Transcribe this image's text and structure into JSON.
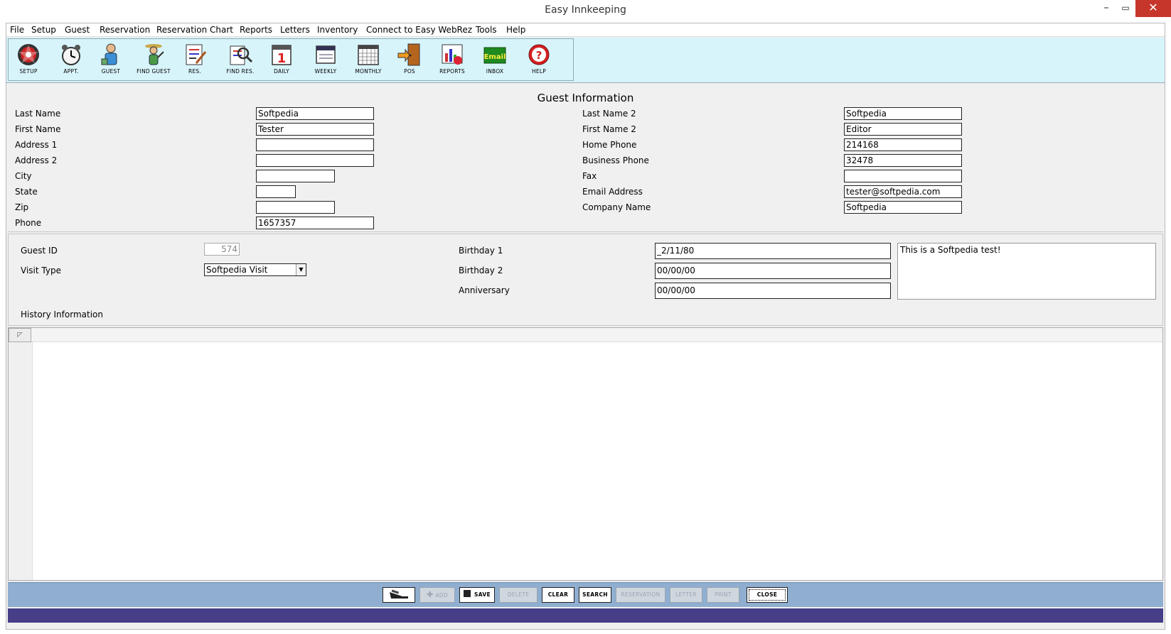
{
  "window": {
    "title": "Easy Innkeeping",
    "min": "–",
    "max": "▭",
    "close": "✕"
  },
  "menu": [
    "File",
    "Setup",
    "Guest",
    "Reservation",
    "Reservation Chart",
    "Reports",
    "Letters",
    "Inventory",
    "Connect to Easy WebRez",
    "Tools",
    "Help"
  ],
  "toolbar": [
    {
      "label": "SETUP",
      "icon": "setup-icon"
    },
    {
      "label": "APPT.",
      "icon": "alarm-clock-icon"
    },
    {
      "label": "GUEST",
      "icon": "guest-icon"
    },
    {
      "label": "FIND GUEST",
      "icon": "find-guest-icon"
    },
    {
      "label": "RES.",
      "icon": "reservation-icon"
    },
    {
      "label": "FIND RES.",
      "icon": "find-reservation-icon"
    },
    {
      "label": "DAILY",
      "icon": "daily-calendar-icon",
      "number": "1"
    },
    {
      "label": "WEEKLY",
      "icon": "weekly-calendar-icon"
    },
    {
      "label": "MONTHLY",
      "icon": "monthly-calendar-icon"
    },
    {
      "label": "POS",
      "icon": "pos-door-icon"
    },
    {
      "label": "REPORTS",
      "icon": "reports-chart-icon"
    },
    {
      "label": "INBOX",
      "icon": "email-icon",
      "text": "Email"
    },
    {
      "label": "HELP",
      "icon": "help-icon",
      "text": "?"
    }
  ],
  "guest_info": {
    "title": "Guest Information",
    "last_name_label": "Last Name",
    "last_name": "Softpedia",
    "first_name_label": "First Name",
    "first_name": "Tester",
    "address1_label": "Address 1",
    "address1": "",
    "address2_label": "Address 2",
    "address2": "",
    "city_label": "City",
    "city": "",
    "state_label": "State",
    "state": "",
    "zip_label": "Zip",
    "zip": "",
    "phone_label": "Phone",
    "phone": "1657357",
    "last_name2_label": "Last Name 2",
    "last_name2": "Softpedia",
    "first_name2_label": "First Name 2",
    "first_name2": "Editor",
    "home_phone_label": "Home Phone",
    "home_phone": "214168",
    "business_phone_label": "Business Phone",
    "business_phone": "32478",
    "fax_label": "Fax",
    "fax": "",
    "email_label": "Email Address",
    "email": "tester@softpedia.com",
    "company_label": "Company Name",
    "company": "Softpedia"
  },
  "details": {
    "guest_id_label": "Guest ID",
    "guest_id": "574",
    "visit_type_label": "Visit Type",
    "visit_type": "Softpedia Visit",
    "birthday1_label": "Birthday 1",
    "birthday1": "_2/11/80",
    "birthday2_label": "Birthday 2",
    "birthday2": "00/00/00",
    "anniversary_label": "Anniversary",
    "anniversary": "00/00/00",
    "notes": "This is a Softpedia test!",
    "history_label": "History Information"
  },
  "grid": {
    "corner": "◸"
  },
  "buttons": {
    "add": "ADD",
    "save": "SAVE",
    "delete": "DELETE",
    "clear": "CLEAR",
    "search": "SEARCH",
    "reservation": "RESERVATION",
    "letter": "LETTER",
    "print": "PRINT",
    "close": "CLOSE"
  },
  "colors": {
    "toolbar_bg": "#d8f4fb",
    "bottom_bar": "#8faed0",
    "status_bar": "#463e86",
    "close_btn": "#c7362b"
  }
}
